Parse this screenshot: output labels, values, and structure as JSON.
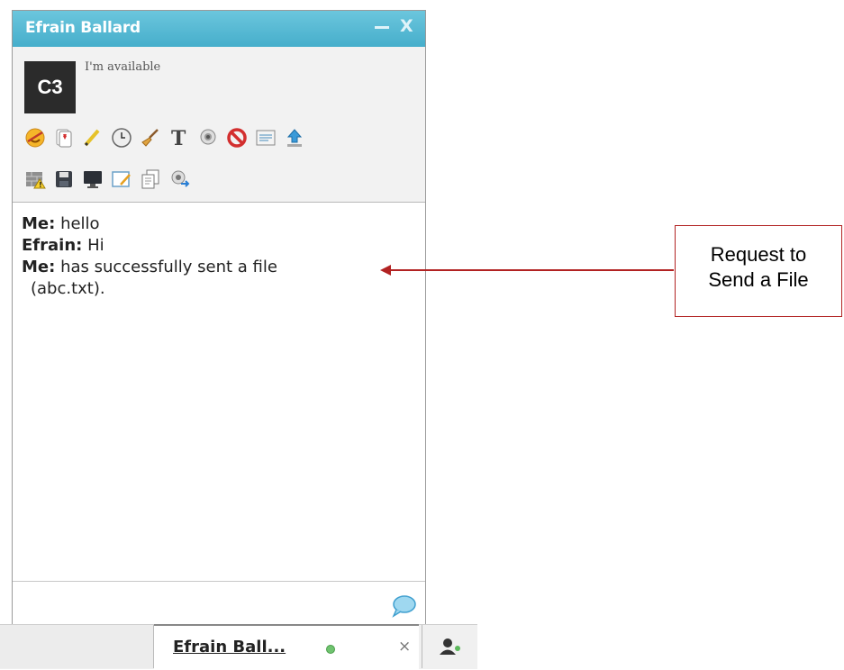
{
  "window": {
    "title": "Efrain Ballard",
    "minimize_label": "—",
    "close_label": "X"
  },
  "profile": {
    "avatar_text": "C3",
    "status_text": "I'm available"
  },
  "toolbar": {
    "row1": [
      "emoticon-icon",
      "cards-icon",
      "pencil-icon",
      "clock-icon",
      "broom-icon",
      "font-icon",
      "webcam-icon",
      "block-icon",
      "window-icon",
      "upload-icon"
    ],
    "row2": [
      "warning-wall-icon",
      "save-icon",
      "monitor-icon",
      "notepad-icon",
      "copy-icon",
      "webcam-send-icon"
    ]
  },
  "messages": [
    {
      "sender": "Me:",
      "text": "hello"
    },
    {
      "sender": "Efrain:",
      "text": "Hi"
    },
    {
      "sender": "Me:",
      "text": "has successfully sent a file",
      "cont": "(abc.txt)."
    }
  ],
  "bottom_bar": {
    "tab_label": "Efrain Ball...",
    "tab_close": "×"
  },
  "annotation": {
    "line1": "Request to",
    "line2": "Send a File",
    "color": "#b22222"
  },
  "colors": {
    "titlebar": "#4fb6d2",
    "status_online": "#6fc36f"
  }
}
